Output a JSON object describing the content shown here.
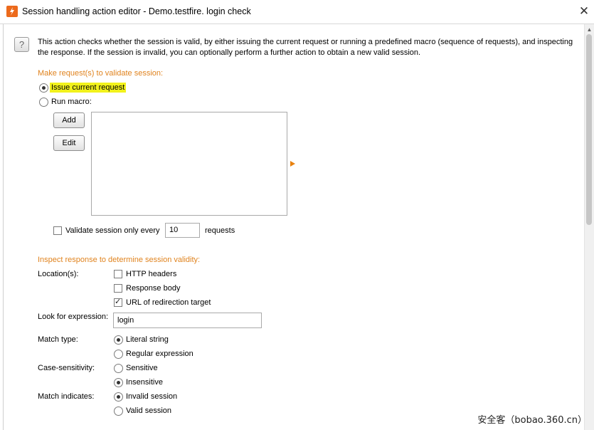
{
  "window": {
    "title": "Session handling action editor - Demo.testfire. login check",
    "close_glyph": "✕"
  },
  "help": {
    "glyph": "?"
  },
  "description": "This action checks whether the session is valid, by either issuing the current request or running a predefined macro (sequence of requests), and inspecting the response. If the session is invalid, you can optionally perform a further action to obtain a new valid session.",
  "request_section": {
    "heading": "Make request(s) to validate session:",
    "options": [
      {
        "label": "Issue current request",
        "selected": true,
        "highlight": "#f2f21c"
      },
      {
        "label": "Run macro:",
        "selected": false
      }
    ],
    "buttons": {
      "add": "Add",
      "edit": "Edit"
    },
    "macros": [],
    "validate_every": {
      "label": "Validate session only every",
      "checked": false,
      "value": "10",
      "suffix": "requests"
    }
  },
  "inspect_section": {
    "heading": "Inspect response to determine session validity:",
    "location_label": "Location(s):",
    "locations": [
      {
        "label": "HTTP headers",
        "checked": false
      },
      {
        "label": "Response body",
        "checked": false
      },
      {
        "label": "URL of redirection target",
        "checked": true
      }
    ],
    "expression_label": "Look for expression:",
    "expression_value": "login",
    "match_type_label": "Match type:",
    "match_types": [
      {
        "label": "Literal string",
        "selected": true
      },
      {
        "label": "Regular expression",
        "selected": false
      }
    ],
    "case_label": "Case-sensitivity:",
    "case_options": [
      {
        "label": "Sensitive",
        "selected": false
      },
      {
        "label": "Insensitive",
        "selected": true
      }
    ],
    "indicates_label": "Match indicates:",
    "indicates_options": [
      {
        "label": "Invalid session",
        "selected": true
      },
      {
        "label": "Valid session",
        "selected": false
      }
    ]
  },
  "watermark": "安全客（bobao.360.cn）",
  "colors": {
    "accent": "#e0831e",
    "app_icon": "#ec6a1c"
  }
}
